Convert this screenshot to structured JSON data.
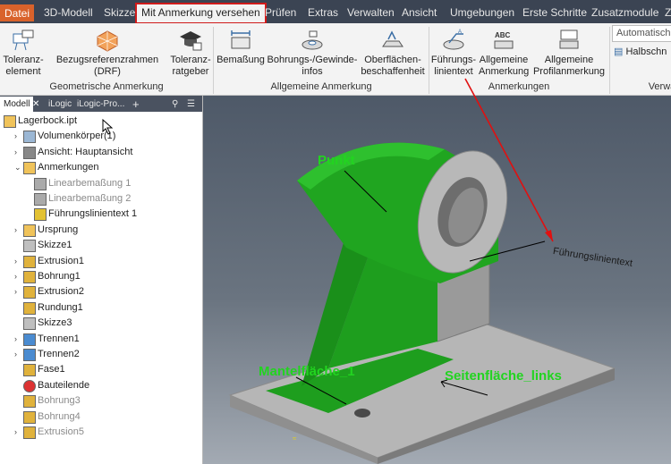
{
  "tabs": [
    "Datei",
    "3D-Modell",
    "Skizze",
    "Mit Anmerkung versehen",
    "Prüfen",
    "Extras",
    "Verwalten",
    "Ansicht",
    "Umgebungen",
    "Erste Schritte",
    "Zusatzmodule",
    "Z"
  ],
  "ribbon": {
    "buttons": {
      "toleranzelement": [
        "Toleranz-",
        "element"
      ],
      "bezugsreferenz": [
        "Bezugsreferenzrahmen (DRF)"
      ],
      "toleranzratgeber": [
        "Toleranz-",
        "ratgeber"
      ],
      "bemassung": [
        "Bemaßung"
      ],
      "bohrungsinfos": [
        "Bohrungs-/Gewinde-",
        "infos"
      ],
      "oberflaeche": [
        "Oberflächen-",
        "beschaffenheit"
      ],
      "fuehrungslinientext": [
        "Führungs-",
        "linientext"
      ],
      "allgemeine_anmerkung": [
        "Allgemeine",
        "Anmerkung"
      ],
      "profilanmerkung": [
        "Allgemeine",
        "Profilanmerkung"
      ]
    },
    "groups": [
      "Geometrische Anmerkung",
      "Allgemeine Anmerkung",
      "Anmerkungen",
      "Verwa"
    ],
    "side": {
      "dropdown": "Automatisch",
      "halbschnitt": "Halbschn"
    }
  },
  "browser": {
    "tabs": [
      "Modell",
      "iLogic",
      "iLogic-Pro...",
      "+"
    ],
    "items": [
      {
        "label": "Lagerbock.ipt",
        "level": 0,
        "icon": "part-icon",
        "expander": ""
      },
      {
        "label": "Volumenkörper(1)",
        "level": 1,
        "icon": "solid-bodies-icon",
        "expander": "›"
      },
      {
        "label": "Ansicht: Hauptansicht",
        "level": 1,
        "icon": "view-icon",
        "expander": "›"
      },
      {
        "label": "Anmerkungen",
        "level": 1,
        "icon": "annotations-folder-icon",
        "expander": "⌄"
      },
      {
        "label": "Linearbemaßung 1",
        "level": 2,
        "icon": "linear-dimension-icon",
        "expander": "",
        "grey": true
      },
      {
        "label": "Linearbemaßung 2",
        "level": 2,
        "icon": "linear-dimension-icon",
        "expander": "",
        "grey": true
      },
      {
        "label": "Führungslinientext 1",
        "level": 2,
        "icon": "leader-text-icon",
        "expander": ""
      },
      {
        "label": "Ursprung",
        "level": 1,
        "icon": "origin-folder-icon",
        "expander": "›"
      },
      {
        "label": "Skizze1",
        "level": 1,
        "icon": "sketch-icon",
        "expander": ""
      },
      {
        "label": "Extrusion1",
        "level": 1,
        "icon": "extrusion-icon",
        "expander": "›"
      },
      {
        "label": "Bohrung1",
        "level": 1,
        "icon": "hole-icon",
        "expander": "›"
      },
      {
        "label": "Extrusion2",
        "level": 1,
        "icon": "extrusion-icon",
        "expander": "›"
      },
      {
        "label": "Rundung1",
        "level": 1,
        "icon": "fillet-icon",
        "expander": ""
      },
      {
        "label": "Skizze3",
        "level": 1,
        "icon": "sketch-icon",
        "expander": ""
      },
      {
        "label": "Trennen1",
        "level": 1,
        "icon": "split-icon",
        "expander": "›"
      },
      {
        "label": "Trennen2",
        "level": 1,
        "icon": "split-icon",
        "expander": "›"
      },
      {
        "label": "Fase1",
        "level": 1,
        "icon": "chamfer-icon",
        "expander": ""
      },
      {
        "label": "Bauteilende",
        "level": 1,
        "icon": "end-of-part-icon",
        "expander": ""
      },
      {
        "label": "Bohrung3",
        "level": 1,
        "icon": "hole-icon",
        "expander": "",
        "grey": true
      },
      {
        "label": "Bohrung4",
        "level": 1,
        "icon": "hole-icon",
        "expander": "",
        "grey": true
      },
      {
        "label": "Extrusion5",
        "level": 1,
        "icon": "extrusion-icon",
        "expander": "›",
        "grey": true
      }
    ]
  },
  "viewport": {
    "labels": {
      "punkt": "Punkt",
      "mantelflaeche": "Mantelfläche_1",
      "seitenflaeche": "Seitenfläche_links",
      "leader_text": "Führungslinientext"
    }
  },
  "colors": {
    "accent": "#d9622b",
    "highlight": "#d01a1a",
    "label": "#22d420",
    "face": "#1e9e1e"
  }
}
